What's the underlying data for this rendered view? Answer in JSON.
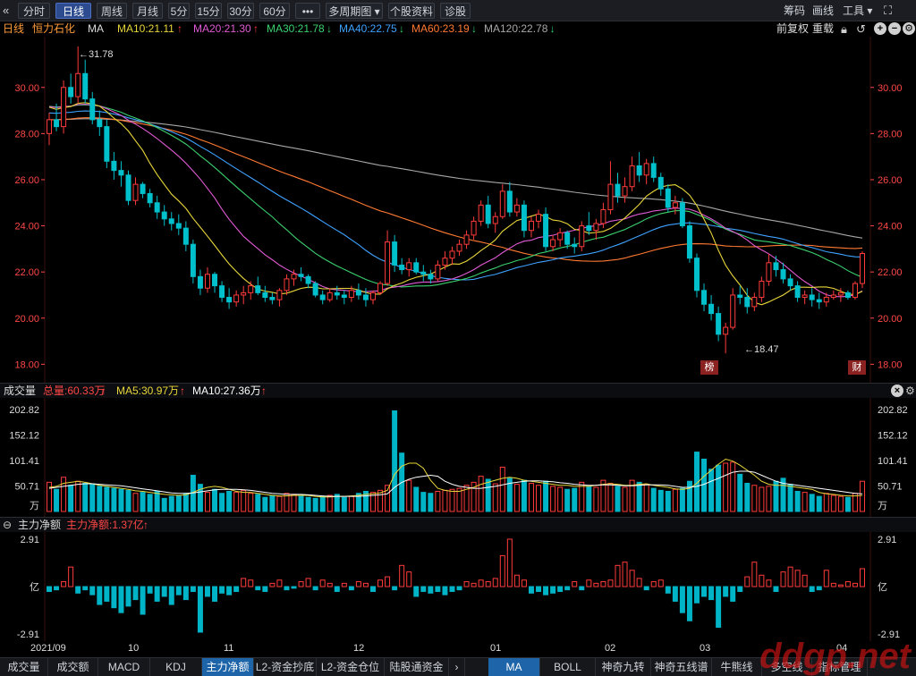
{
  "toolbar": {
    "collapse_icon": "double-chevron-left-icon",
    "tabs": [
      "分时",
      "日线",
      "周线",
      "月线",
      "5分",
      "15分",
      "30分",
      "60分",
      "•••",
      "多周期图 ▾",
      "个股资料",
      "诊股"
    ],
    "active_tab": "日线",
    "right": {
      "chips": "筹码",
      "draw": "画线",
      "tools": "工具 ▾"
    },
    "expand_icon": "fullscreen-icon"
  },
  "ma_line": {
    "period": "日线",
    "stock": "恒力石化",
    "ma_label": "MA",
    "items": [
      {
        "text": "MA10:21.11",
        "arrow": "↑",
        "color": "#e8d63a",
        "arrow_color": "#ff3b3b"
      },
      {
        "text": "MA20:21.30",
        "arrow": "↑",
        "color": "#e05ad4",
        "arrow_color": "#ff3b3b"
      },
      {
        "text": "MA30:21.78",
        "arrow": "↓",
        "color": "#3bd16f",
        "arrow_color": "#2fd46c"
      },
      {
        "text": "MA40:22.75",
        "arrow": "↓",
        "color": "#3ea2ff",
        "arrow_color": "#2fd46c"
      },
      {
        "text": "MA60:23.19",
        "arrow": "↓",
        "color": "#ff7a33",
        "arrow_color": "#2fd46c"
      },
      {
        "text": "MA120:22.78",
        "arrow": "↓",
        "color": "#a7a7a7",
        "arrow_color": "#2fd46c"
      }
    ],
    "right": {
      "adjust": "前复权",
      "overlay": "重载"
    }
  },
  "price_axis": {
    "labels": [
      "30.00",
      "28.00",
      "26.00",
      "24.00",
      "22.00",
      "20.00",
      "18.00"
    ],
    "values": [
      30,
      28,
      26,
      24,
      22,
      20,
      18
    ],
    "color": "#ff4747"
  },
  "annotations": {
    "high": "←31.78",
    "low": "←18.47",
    "marker_bang": "榜",
    "marker_fin": "财"
  },
  "volume": {
    "title": "成交量",
    "total": "总量:60.33万",
    "ma5": "MA5:30.97万",
    "ma10": "MA10:27.36万",
    "axis_labels": [
      "202.82",
      "152.12",
      "101.41",
      "50.71",
      "万"
    ],
    "axis_values": [
      202.82,
      152.12,
      101.41,
      50.71
    ]
  },
  "flow": {
    "title": "主力净额",
    "value": "主力净额:1.37亿",
    "axis_labels": [
      "2.91",
      "亿",
      "-2.91"
    ],
    "axis_values": [
      2.91,
      0,
      -2.91
    ]
  },
  "x_axis": {
    "labels": [
      "2021/09",
      "10",
      "11",
      "12",
      "01",
      "02",
      "03",
      "04"
    ]
  },
  "bottom_tabs": {
    "left": [
      "成交量",
      "成交额",
      "MACD",
      "KDJ",
      "主力净额",
      "L2-资金抄底",
      "L2-资金仓位",
      "陆股通资金"
    ],
    "active_left": "主力净额",
    "right": [
      "MA",
      "BOLL",
      "神奇九转",
      "神奇五线谱",
      "牛熊线",
      "多空线",
      "指标管理"
    ],
    "active_right": "MA"
  },
  "watermark": "ddgp.net",
  "chart_data": [
    {
      "type": "candlestick",
      "title": "恒力石化 日线",
      "ylim": [
        17.2,
        32.2
      ],
      "yticks": [
        30,
        28,
        26,
        24,
        22,
        20,
        18
      ],
      "x_labels": [
        "2021/09",
        "10",
        "11",
        "12",
        "01",
        "02",
        "03",
        "04"
      ],
      "candles": [
        [
          28.0,
          28.9,
          27.5,
          28.6
        ],
        [
          28.6,
          29.3,
          28.1,
          28.3
        ],
        [
          28.3,
          30.3,
          28.0,
          30.0
        ],
        [
          30.0,
          30.6,
          29.3,
          29.6
        ],
        [
          29.6,
          31.78,
          29.3,
          30.6
        ],
        [
          30.6,
          31.2,
          29.3,
          29.5
        ],
        [
          29.5,
          29.8,
          28.4,
          28.6
        ],
        [
          28.6,
          29.0,
          27.9,
          28.3
        ],
        [
          28.3,
          28.6,
          26.5,
          26.8
        ],
        [
          26.8,
          27.2,
          26.0,
          26.4
        ],
        [
          26.4,
          26.8,
          25.7,
          26.2
        ],
        [
          26.2,
          26.4,
          24.9,
          25.1
        ],
        [
          25.1,
          26.1,
          24.9,
          25.8
        ],
        [
          25.8,
          25.9,
          25.2,
          25.4
        ],
        [
          25.4,
          25.6,
          24.8,
          25.0
        ],
        [
          25.0,
          25.3,
          24.3,
          24.6
        ],
        [
          24.6,
          24.9,
          24.0,
          24.3
        ],
        [
          24.3,
          24.6,
          23.8,
          24.1
        ],
        [
          24.1,
          24.5,
          23.6,
          23.9
        ],
        [
          23.9,
          24.2,
          22.9,
          23.2
        ],
        [
          23.2,
          23.4,
          21.5,
          21.8
        ],
        [
          21.8,
          22.1,
          21.0,
          21.3
        ],
        [
          21.3,
          22.2,
          21.1,
          21.9
        ],
        [
          21.9,
          22.0,
          21.1,
          21.4
        ],
        [
          21.4,
          21.6,
          20.7,
          20.9
        ],
        [
          20.9,
          21.3,
          20.4,
          20.7
        ],
        [
          20.7,
          21.2,
          20.5,
          21.0
        ],
        [
          21.0,
          21.4,
          20.6,
          21.1
        ],
        [
          21.1,
          21.6,
          20.8,
          21.4
        ],
        [
          21.4,
          21.8,
          21.0,
          21.1
        ],
        [
          21.1,
          21.4,
          20.7,
          20.9
        ],
        [
          20.9,
          21.1,
          20.6,
          20.8
        ],
        [
          20.8,
          21.3,
          20.5,
          21.2
        ],
        [
          21.2,
          21.9,
          21.0,
          21.7
        ],
        [
          21.7,
          22.1,
          21.4,
          21.9
        ],
        [
          21.9,
          22.2,
          21.6,
          21.8
        ],
        [
          21.8,
          21.9,
          21.3,
          21.5
        ],
        [
          21.5,
          21.6,
          20.9,
          21.0
        ],
        [
          21.0,
          21.2,
          20.6,
          20.8
        ],
        [
          20.8,
          21.3,
          20.7,
          21.1
        ],
        [
          21.1,
          21.4,
          20.8,
          21.0
        ],
        [
          21.0,
          21.2,
          20.6,
          20.9
        ],
        [
          20.9,
          21.4,
          20.7,
          21.2
        ],
        [
          21.2,
          21.5,
          20.8,
          21.0
        ],
        [
          21.0,
          21.3,
          20.5,
          20.8
        ],
        [
          20.8,
          21.2,
          20.6,
          21.1
        ],
        [
          21.1,
          21.6,
          21.0,
          21.5
        ],
        [
          21.5,
          23.8,
          21.4,
          23.3
        ],
        [
          23.3,
          23.6,
          22.0,
          22.3
        ],
        [
          22.3,
          22.6,
          21.9,
          22.1
        ],
        [
          22.1,
          22.6,
          21.8,
          22.4
        ],
        [
          22.4,
          22.6,
          21.9,
          22.0
        ],
        [
          22.0,
          22.3,
          21.6,
          21.9
        ],
        [
          21.9,
          22.1,
          21.5,
          21.7
        ],
        [
          21.7,
          22.5,
          21.6,
          22.3
        ],
        [
          22.3,
          22.9,
          22.1,
          22.6
        ],
        [
          22.6,
          23.1,
          22.3,
          22.9
        ],
        [
          22.9,
          23.4,
          22.7,
          23.2
        ],
        [
          23.2,
          23.8,
          23.0,
          23.6
        ],
        [
          23.6,
          24.4,
          23.4,
          24.2
        ],
        [
          24.2,
          25.1,
          24.0,
          24.9
        ],
        [
          24.9,
          25.3,
          23.9,
          24.1
        ],
        [
          24.1,
          24.6,
          23.7,
          24.4
        ],
        [
          24.4,
          25.8,
          24.3,
          25.5
        ],
        [
          25.5,
          25.9,
          24.4,
          24.6
        ],
        [
          24.6,
          25.2,
          24.4,
          24.9
        ],
        [
          24.9,
          25.1,
          23.5,
          23.8
        ],
        [
          23.8,
          24.4,
          23.5,
          24.2
        ],
        [
          24.2,
          24.7,
          23.9,
          24.5
        ],
        [
          24.5,
          24.8,
          22.9,
          23.1
        ],
        [
          23.1,
          23.6,
          22.9,
          23.4
        ],
        [
          23.4,
          23.9,
          23.1,
          23.7
        ],
        [
          23.7,
          23.8,
          23.0,
          23.2
        ],
        [
          23.2,
          23.5,
          22.8,
          23.1
        ],
        [
          23.1,
          24.2,
          22.9,
          24.0
        ],
        [
          24.0,
          24.6,
          23.6,
          23.8
        ],
        [
          23.8,
          24.3,
          23.4,
          24.1
        ],
        [
          24.1,
          25.0,
          23.9,
          24.7
        ],
        [
          24.7,
          26.8,
          24.5,
          25.8
        ],
        [
          25.8,
          26.3,
          25.0,
          25.3
        ],
        [
          25.3,
          26.1,
          25.0,
          25.7
        ],
        [
          25.7,
          27.0,
          25.5,
          26.6
        ],
        [
          26.6,
          27.2,
          25.9,
          26.2
        ],
        [
          26.2,
          26.9,
          25.8,
          26.7
        ],
        [
          26.7,
          27.0,
          25.9,
          26.1
        ],
        [
          26.1,
          26.3,
          25.3,
          25.6
        ],
        [
          25.6,
          25.8,
          24.6,
          24.8
        ],
        [
          24.8,
          25.3,
          24.5,
          25.0
        ],
        [
          25.0,
          25.2,
          23.9,
          24.0
        ],
        [
          24.0,
          24.2,
          22.4,
          22.6
        ],
        [
          22.6,
          22.8,
          20.9,
          21.2
        ],
        [
          21.2,
          21.5,
          20.3,
          20.6
        ],
        [
          20.6,
          21.0,
          19.9,
          20.2
        ],
        [
          20.2,
          20.5,
          19.0,
          19.3
        ],
        [
          19.3,
          19.8,
          18.47,
          19.6
        ],
        [
          19.6,
          21.3,
          19.5,
          21.0
        ],
        [
          21.0,
          21.4,
          20.6,
          20.9
        ],
        [
          20.9,
          21.3,
          20.2,
          20.5
        ],
        [
          20.5,
          21.1,
          20.3,
          20.9
        ],
        [
          20.9,
          21.8,
          20.7,
          21.6
        ],
        [
          21.6,
          22.8,
          21.4,
          22.4
        ],
        [
          22.4,
          22.7,
          21.8,
          22.1
        ],
        [
          22.1,
          22.4,
          21.5,
          21.7
        ],
        [
          21.7,
          21.9,
          21.2,
          21.4
        ],
        [
          21.4,
          21.6,
          20.7,
          20.9
        ],
        [
          20.9,
          21.2,
          20.6,
          21.0
        ],
        [
          21.0,
          21.3,
          20.5,
          20.8
        ],
        [
          20.8,
          21.1,
          20.4,
          20.7
        ],
        [
          20.7,
          21.1,
          20.5,
          20.9
        ],
        [
          20.9,
          21.2,
          20.8,
          21.0
        ],
        [
          21.0,
          21.3,
          20.7,
          21.1
        ],
        [
          21.1,
          21.2,
          20.8,
          20.9
        ],
        [
          20.9,
          21.6,
          20.8,
          21.5
        ],
        [
          21.5,
          22.9,
          21.3,
          22.8
        ]
      ]
    },
    {
      "type": "bar",
      "title": "成交量",
      "ylim": [
        0,
        215
      ],
      "values": [
        58,
        44,
        68,
        52,
        60,
        56,
        55,
        50,
        48,
        46,
        44,
        42,
        36,
        38,
        34,
        40,
        26,
        30,
        32,
        36,
        72,
        54,
        38,
        44,
        36,
        40,
        38,
        42,
        36,
        34,
        28,
        32,
        30,
        36,
        34,
        30,
        28,
        26,
        30,
        32,
        34,
        28,
        30,
        36,
        40,
        38,
        42,
        52,
        200,
        116,
        62,
        48,
        38,
        36,
        40,
        42,
        44,
        46,
        52,
        58,
        70,
        64,
        55,
        88,
        66,
        54,
        62,
        56,
        52,
        60,
        50,
        48,
        44,
        46,
        58,
        50,
        48,
        62,
        56,
        50,
        48,
        62,
        58,
        54,
        46,
        42,
        40,
        44,
        46,
        60,
        118,
        104,
        84,
        92,
        96,
        98,
        74,
        56,
        52,
        48,
        50,
        60,
        66,
        54,
        40,
        38,
        34,
        30,
        36,
        32,
        30,
        28,
        36,
        60
      ],
      "ma5": [
        48,
        50,
        56,
        58,
        60,
        58,
        55,
        52,
        50,
        48,
        46,
        44,
        41,
        40,
        38,
        36,
        34,
        33,
        32,
        33,
        38,
        44,
        48,
        50,
        48,
        44,
        40,
        38,
        38,
        36,
        34,
        32,
        31,
        31,
        32,
        32,
        32,
        30,
        29,
        29,
        30,
        30,
        31,
        32,
        34,
        35,
        37,
        42,
        74,
        90,
        96,
        96,
        86,
        62,
        46,
        42,
        40,
        40,
        44,
        48,
        54,
        58,
        62,
        66,
        68,
        66,
        62,
        60,
        58,
        56,
        54,
        52,
        52,
        50,
        50,
        50,
        52,
        54,
        55,
        54,
        52,
        52,
        54,
        55,
        52,
        50,
        48,
        45,
        44,
        46,
        56,
        70,
        82,
        94,
        104,
        100,
        92,
        82,
        72,
        60,
        54,
        52,
        52,
        50,
        48,
        46,
        44,
        38,
        35,
        34,
        32,
        31,
        31,
        32
      ],
      "ma10": [
        46,
        48,
        50,
        52,
        54,
        55,
        55,
        54,
        53,
        52,
        51,
        49,
        47,
        45,
        43,
        41,
        39,
        37,
        36,
        36,
        37,
        39,
        41,
        43,
        44,
        44,
        44,
        43,
        42,
        40,
        38,
        36,
        35,
        34,
        34,
        34,
        33,
        32,
        31,
        30,
        30,
        30,
        30,
        30,
        31,
        32,
        33,
        35,
        48,
        58,
        64,
        68,
        70,
        72,
        70,
        60,
        54,
        50,
        48,
        46,
        46,
        48,
        50,
        53,
        56,
        58,
        60,
        61,
        61,
        60,
        59,
        57,
        56,
        54,
        53,
        52,
        52,
        53,
        53,
        52,
        51,
        51,
        52,
        53,
        53,
        53,
        52,
        50,
        48,
        48,
        50,
        54,
        60,
        66,
        72,
        78,
        80,
        80,
        78,
        72,
        66,
        60,
        56,
        54,
        52,
        50,
        48,
        46,
        44,
        42,
        40,
        38,
        36,
        35
      ],
      "series_colors": {
        "up": "#ff3b3b",
        "down": "#00b4c8",
        "ma5": "#e8d63a",
        "ma10": "#ffffff"
      }
    },
    {
      "type": "bar",
      "title": "主力净额",
      "ylim": [
        -2.91,
        2.91
      ],
      "values": [
        -0.3,
        -0.2,
        0.3,
        1.2,
        -0.4,
        -0.2,
        -0.5,
        -1.1,
        -0.9,
        -1.3,
        -1.6,
        -1.2,
        -0.8,
        -1.7,
        -0.4,
        -0.9,
        -0.6,
        -1.1,
        -0.5,
        -0.8,
        -0.3,
        -2.8,
        -0.6,
        -0.9,
        -0.4,
        -0.5,
        -0.3,
        0.5,
        0.4,
        -0.2,
        -0.3,
        0.2,
        0.4,
        -0.2,
        -0.1,
        0.3,
        0.5,
        -0.2,
        0.4,
        0.2,
        -0.3,
        0.2,
        -0.2,
        0.3,
        0.2,
        -0.3,
        0.4,
        0.6,
        -0.2,
        1.3,
        0.9,
        -0.6,
        -0.3,
        -0.4,
        -0.3,
        -0.5,
        -0.3,
        -0.2,
        0.3,
        0.2,
        0.4,
        0.3,
        0.5,
        1.9,
        2.91,
        0.7,
        0.4,
        -0.4,
        -0.3,
        -0.5,
        -0.4,
        -0.3,
        -0.2,
        0.3,
        -0.2,
        0.4,
        0.2,
        0.3,
        0.4,
        1.3,
        1.5,
        1.0,
        0.5,
        -0.2,
        0.3,
        0.4,
        -0.4,
        -0.9,
        -1.6,
        -2.1,
        -1.0,
        -0.6,
        -0.8,
        -2.5,
        -0.6,
        -0.9,
        -0.3,
        0.6,
        1.5,
        0.7,
        0.4,
        -0.3,
        0.9,
        1.2,
        1.0,
        0.7,
        -0.3,
        -0.2,
        1.0,
        0.2,
        0.1,
        0.3,
        0.2,
        1.1
      ],
      "series_colors": {
        "up": "#ff3b3b",
        "down": "#00b4c8"
      }
    }
  ]
}
